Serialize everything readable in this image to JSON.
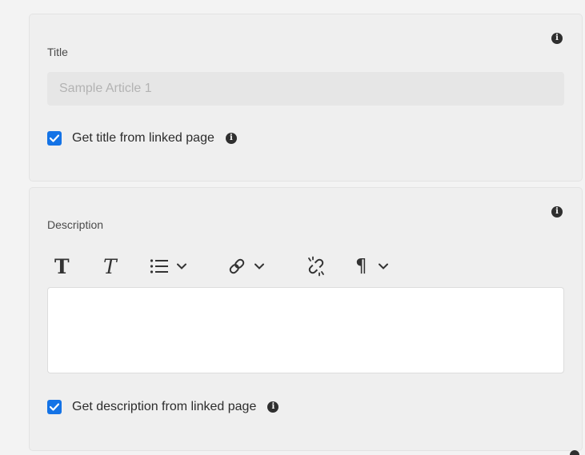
{
  "title_section": {
    "label": "Title",
    "input_placeholder": "Sample Article 1",
    "checkbox_label": "Get title from linked page",
    "checkbox_checked": true
  },
  "description_section": {
    "label": "Description",
    "toolbar": {
      "bold_glyph": "T",
      "italic_glyph": "T",
      "paragraph_glyph": "¶",
      "icons": [
        "bold-icon",
        "italic-icon",
        "list-icon",
        "link-icon",
        "unlink-icon",
        "paragraph-icon"
      ]
    },
    "editor_value": "",
    "checkbox_label": "Get description from linked page",
    "checkbox_checked": true
  },
  "info_glyph": "i",
  "colors": {
    "accent": "#1473e6",
    "panel_bg": "#efefef",
    "page_bg": "#f3f3f3",
    "input_bg": "#e6e6e6"
  }
}
